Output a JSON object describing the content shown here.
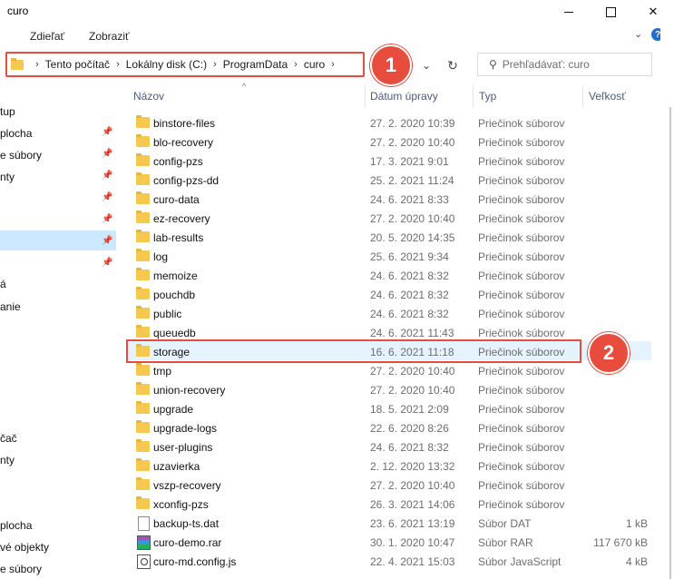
{
  "window": {
    "title": "curo"
  },
  "ribbon": {
    "tabs": [
      "Zdieľať",
      "Zobraziť"
    ]
  },
  "address": {
    "crumbs": [
      "Tento počítač",
      "Lokálny disk (C:)",
      "ProgramData",
      "curo"
    ]
  },
  "search": {
    "placeholder": "Prehľadávať: curo"
  },
  "annotations": {
    "badge1": "1",
    "badge2": "2"
  },
  "nav": {
    "items": [
      {
        "label": "tup",
        "pinned": false
      },
      {
        "label": "plocha",
        "pinned": true
      },
      {
        "label": "e súbory",
        "pinned": true
      },
      {
        "label": "nty",
        "pinned": true
      },
      {
        "label": "",
        "pinned": true
      },
      {
        "label": "",
        "pinned": true
      },
      {
        "label": "",
        "pinned": true
      },
      {
        "label": "",
        "pinned": true
      },
      {
        "label": "á",
        "pinned": false
      },
      {
        "label": "anie",
        "pinned": false
      },
      {
        "label": "čač",
        "pinned": false
      },
      {
        "label": "nty",
        "pinned": false
      },
      {
        "label": "plocha",
        "pinned": false
      },
      {
        "label": "vé objekty",
        "pinned": false
      },
      {
        "label": "e súbory",
        "pinned": false
      }
    ]
  },
  "columns": {
    "name": "Názov",
    "date": "Dátum úpravy",
    "type": "Typ",
    "size": "Veľkosť"
  },
  "files": [
    {
      "name": "binstore-files",
      "date": "27. 2. 2020 10:39",
      "type": "Priečinok súborov",
      "size": "",
      "icon": "folder-icon"
    },
    {
      "name": "blo-recovery",
      "date": "27. 2. 2020 10:40",
      "type": "Priečinok súborov",
      "size": "",
      "icon": "folder-icon"
    },
    {
      "name": "config-pzs",
      "date": "17. 3. 2021 9:01",
      "type": "Priečinok súborov",
      "size": "",
      "icon": "folder-icon"
    },
    {
      "name": "config-pzs-dd",
      "date": "25. 2. 2021 11:24",
      "type": "Priečinok súborov",
      "size": "",
      "icon": "folder-icon"
    },
    {
      "name": "curo-data",
      "date": "24. 6. 2021 8:33",
      "type": "Priečinok súborov",
      "size": "",
      "icon": "folder-icon"
    },
    {
      "name": "ez-recovery",
      "date": "27. 2. 2020 10:40",
      "type": "Priečinok súborov",
      "size": "",
      "icon": "folder-icon"
    },
    {
      "name": "lab-results",
      "date": "20. 5. 2020 14:35",
      "type": "Priečinok súborov",
      "size": "",
      "icon": "folder-icon"
    },
    {
      "name": "log",
      "date": "25. 6. 2021 9:34",
      "type": "Priečinok súborov",
      "size": "",
      "icon": "folder-icon"
    },
    {
      "name": "memoize",
      "date": "24. 6. 2021 8:32",
      "type": "Priečinok súborov",
      "size": "",
      "icon": "folder-icon"
    },
    {
      "name": "pouchdb",
      "date": "24. 6. 2021 8:32",
      "type": "Priečinok súborov",
      "size": "",
      "icon": "folder-icon"
    },
    {
      "name": "public",
      "date": "24. 6. 2021 8:32",
      "type": "Priečinok súborov",
      "size": "",
      "icon": "folder-icon"
    },
    {
      "name": "queuedb",
      "date": "24. 6. 2021 11:43",
      "type": "Priečinok súborov",
      "size": "",
      "icon": "folder-icon"
    },
    {
      "name": "storage",
      "date": "16. 6. 2021 11:18",
      "type": "Priečinok súborov",
      "size": "",
      "icon": "folder-icon"
    },
    {
      "name": "tmp",
      "date": "27. 2. 2020 10:40",
      "type": "Priečinok súborov",
      "size": "",
      "icon": "folder-icon"
    },
    {
      "name": "union-recovery",
      "date": "27. 2. 2020 10:40",
      "type": "Priečinok súborov",
      "size": "",
      "icon": "folder-icon"
    },
    {
      "name": "upgrade",
      "date": "18. 5. 2021 2:09",
      "type": "Priečinok súborov",
      "size": "",
      "icon": "folder-icon"
    },
    {
      "name": "upgrade-logs",
      "date": "22. 6. 2020 8:26",
      "type": "Priečinok súborov",
      "size": "",
      "icon": "folder-icon"
    },
    {
      "name": "user-plugins",
      "date": "24. 6. 2021 8:32",
      "type": "Priečinok súborov",
      "size": "",
      "icon": "folder-icon"
    },
    {
      "name": "uzavierka",
      "date": "2. 12. 2020 13:32",
      "type": "Priečinok súborov",
      "size": "",
      "icon": "folder-icon"
    },
    {
      "name": "vszp-recovery",
      "date": "27. 2. 2020 10:40",
      "type": "Priečinok súborov",
      "size": "",
      "icon": "folder-icon"
    },
    {
      "name": "xconfig-pzs",
      "date": "26. 3. 2021 14:06",
      "type": "Priečinok súborov",
      "size": "",
      "icon": "folder-icon"
    },
    {
      "name": "backup-ts.dat",
      "date": "23. 6. 2021 13:19",
      "type": "Súbor DAT",
      "size": "1 kB",
      "icon": "file-icon"
    },
    {
      "name": "curo-demo.rar",
      "date": "30. 1. 2020 10:47",
      "type": "Súbor RAR",
      "size": "117 670 kB",
      "icon": "rar-archive-icon"
    },
    {
      "name": "curo-md.config.js",
      "date": "22. 4. 2021 15:03",
      "type": "Súbor JavaScript",
      "size": "4 kB",
      "icon": "js-file-icon"
    }
  ],
  "selected_file": "storage",
  "colors": {
    "highlight": "#e74c3c",
    "selection": "#e5f3ff",
    "folder": "#f5c84f"
  }
}
